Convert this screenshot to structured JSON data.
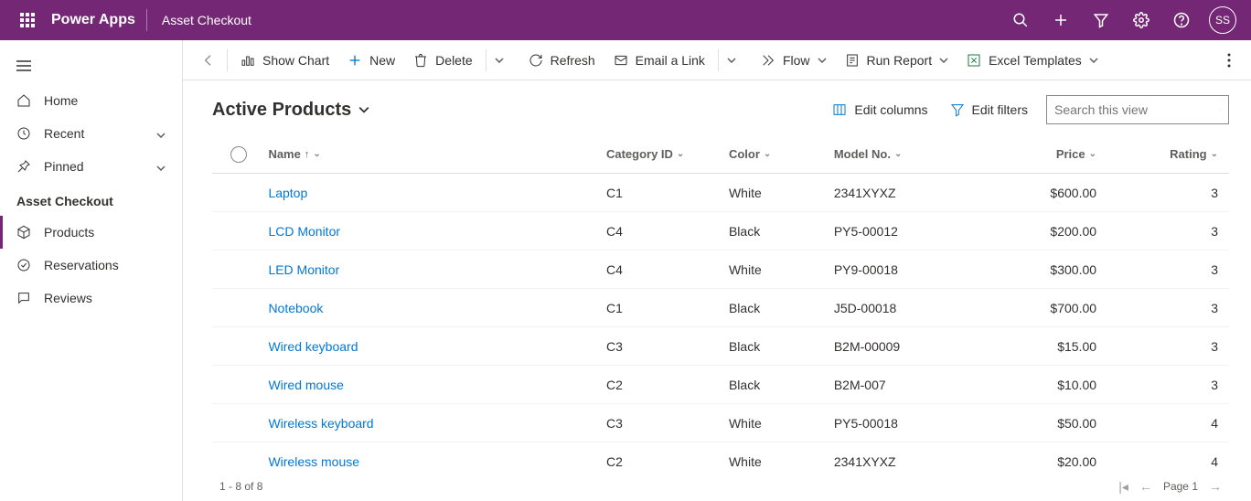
{
  "topbar": {
    "app_name": "Power Apps",
    "page_title": "Asset Checkout",
    "avatar": "SS"
  },
  "sidebar": {
    "home": "Home",
    "recent": "Recent",
    "pinned": "Pinned",
    "section": "Asset Checkout",
    "products": "Products",
    "reservations": "Reservations",
    "reviews": "Reviews"
  },
  "cmdbar": {
    "show_chart": "Show Chart",
    "new": "New",
    "delete": "Delete",
    "refresh": "Refresh",
    "email": "Email a Link",
    "flow": "Flow",
    "run_report": "Run Report",
    "excel": "Excel Templates"
  },
  "content": {
    "view_title": "Active Products",
    "edit_columns": "Edit columns",
    "edit_filters": "Edit filters",
    "search_placeholder": "Search this view"
  },
  "columns": {
    "name": "Name",
    "category": "Category ID",
    "color": "Color",
    "model": "Model No.",
    "price": "Price",
    "rating": "Rating"
  },
  "rows": [
    {
      "name": "Laptop",
      "cat": "C1",
      "color": "White",
      "model": "2341XYXZ",
      "price": "$600.00",
      "rating": "3"
    },
    {
      "name": "LCD Monitor",
      "cat": "C4",
      "color": "Black",
      "model": "PY5-00012",
      "price": "$200.00",
      "rating": "3"
    },
    {
      "name": "LED Monitor",
      "cat": "C4",
      "color": "White",
      "model": "PY9-00018",
      "price": "$300.00",
      "rating": "3"
    },
    {
      "name": "Notebook",
      "cat": "C1",
      "color": "Black",
      "model": "J5D-00018",
      "price": "$700.00",
      "rating": "3"
    },
    {
      "name": "Wired keyboard",
      "cat": "C3",
      "color": "Black",
      "model": "B2M-00009",
      "price": "$15.00",
      "rating": "3"
    },
    {
      "name": "Wired mouse",
      "cat": "C2",
      "color": "Black",
      "model": "B2M-007",
      "price": "$10.00",
      "rating": "3"
    },
    {
      "name": "Wireless keyboard",
      "cat": "C3",
      "color": "White",
      "model": "PY5-00018",
      "price": "$50.00",
      "rating": "4"
    },
    {
      "name": "Wireless mouse",
      "cat": "C2",
      "color": "White",
      "model": "2341XYXZ",
      "price": "$20.00",
      "rating": "4"
    }
  ],
  "footer": {
    "count": "1 - 8 of 8",
    "page": "Page 1"
  }
}
